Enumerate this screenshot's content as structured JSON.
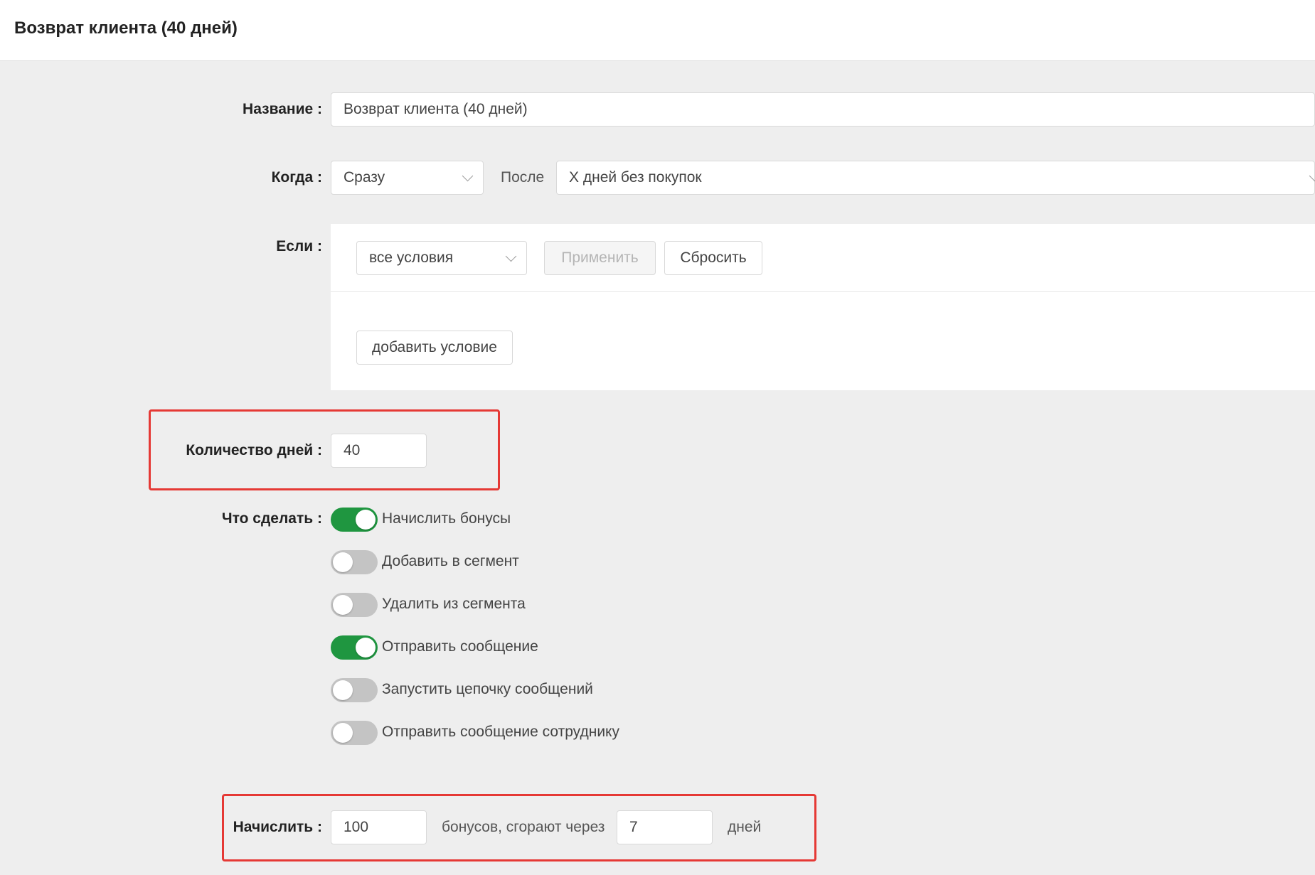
{
  "header": {
    "title": "Возврат клиента (40 дней)"
  },
  "form": {
    "name": {
      "label": "Название",
      "value": "Возврат клиента (40 дней)"
    },
    "when": {
      "label": "Когда",
      "timing_value": "Сразу",
      "after_text": "После",
      "event_value": "X дней без покупок"
    },
    "if": {
      "label": "Если",
      "conditions_mode": "все условия",
      "apply_label": "Применить",
      "reset_label": "Сбросить",
      "add_condition_label": "добавить условие"
    },
    "days": {
      "label": "Количество дней",
      "value": "40"
    },
    "actions": {
      "label": "Что сделать",
      "items": [
        {
          "label": "Начислить бонусы",
          "enabled": true
        },
        {
          "label": "Добавить в сегмент",
          "enabled": false
        },
        {
          "label": "Удалить из сегмента",
          "enabled": false
        },
        {
          "label": "Отправить сообщение",
          "enabled": true
        },
        {
          "label": "Запустить цепочку сообщений",
          "enabled": false
        },
        {
          "label": "Отправить сообщение сотруднику",
          "enabled": false
        }
      ]
    },
    "accrue": {
      "label": "Начислить",
      "bonus_amount": "100",
      "middle_text": "бонусов, сгорают через",
      "expire_days": "7",
      "days_text": "дней"
    }
  },
  "colors": {
    "toggle_on": "#1f9640",
    "toggle_off": "#c4c4c4",
    "highlight": "#e53935"
  }
}
